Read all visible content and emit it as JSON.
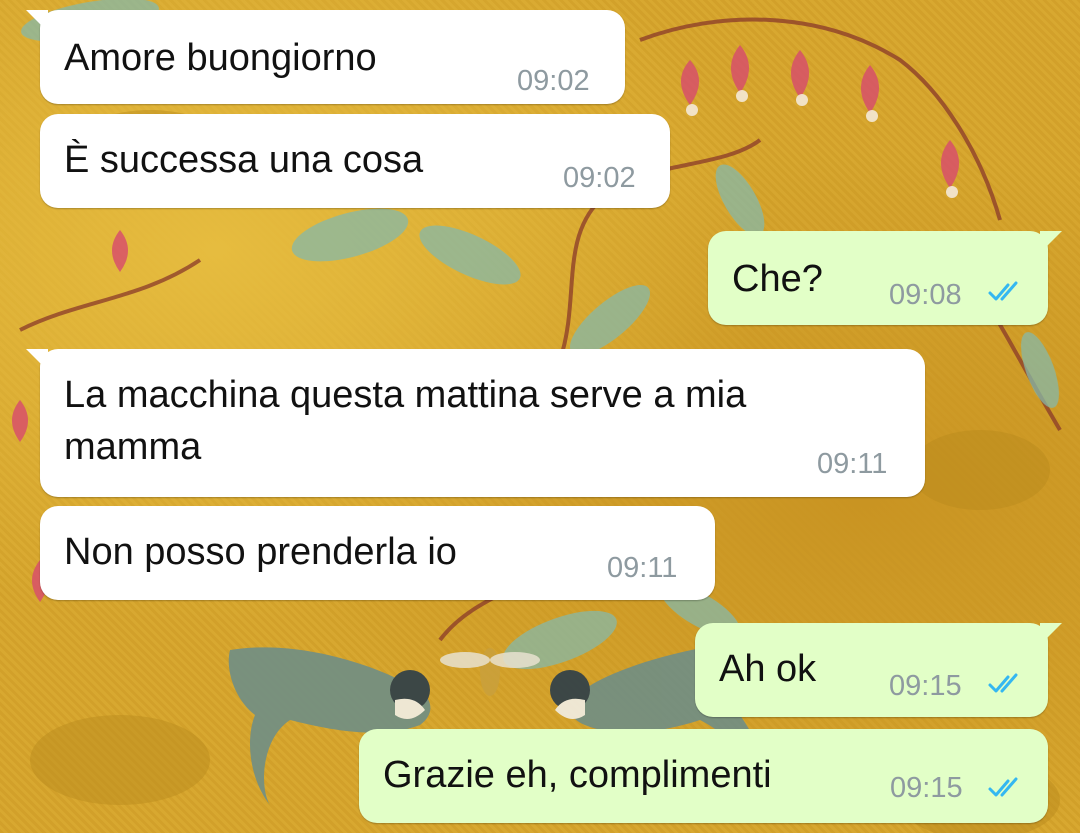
{
  "chat": {
    "messages": [
      {
        "direction": "incoming",
        "text": "Amore buongiorno",
        "time": "09:02"
      },
      {
        "direction": "incoming",
        "text": "È successa una cosa",
        "time": "09:02"
      },
      {
        "direction": "outgoing",
        "text": "Che?",
        "time": "09:08",
        "status": "read"
      },
      {
        "direction": "incoming",
        "text": "La macchina questa mattina serve a mia mamma",
        "time": "09:11"
      },
      {
        "direction": "incoming",
        "text": "Non posso prenderla io",
        "time": "09:11"
      },
      {
        "direction": "outgoing",
        "text": "Ah ok",
        "time": "09:15",
        "status": "read"
      },
      {
        "direction": "outgoing",
        "text": "Grazie eh, complimenti",
        "time": "09:15",
        "status": "read"
      }
    ],
    "colors": {
      "incoming_bubble": "#ffffff",
      "outgoing_bubble": "#e2ffc7",
      "read_ticks": "#34b7f1",
      "timestamp": "#8e9aa0",
      "wallpaper": "#d6a52c"
    },
    "icons": {
      "read_receipt": "double-check-icon"
    }
  }
}
